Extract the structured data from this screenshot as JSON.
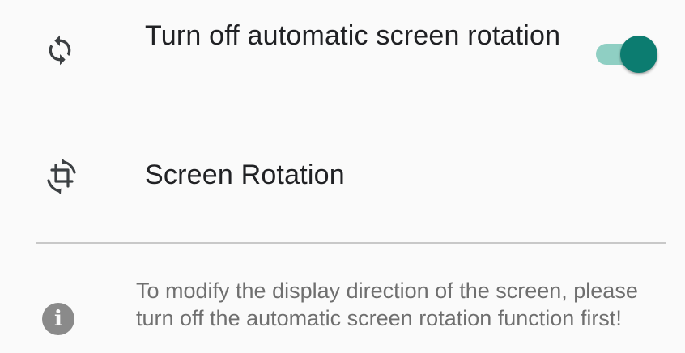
{
  "settings": {
    "auto_rotate": {
      "label": "Turn off automatic screen rotation",
      "icon": "sync-icon",
      "toggle_on": true
    },
    "screen_rotation": {
      "label": "Screen Rotation",
      "icon": "rotate-crop-icon"
    }
  },
  "info": {
    "icon": "info-icon",
    "icon_glyph": "i",
    "text": "To modify the display direction of the screen, please turn off the automatic screen rotation function first!"
  },
  "colors": {
    "accent": "#0c7c70",
    "accent_track": "#8fcfc3",
    "text_primary": "#202124",
    "text_secondary": "#6f6f6f",
    "background": "#fafafa"
  }
}
